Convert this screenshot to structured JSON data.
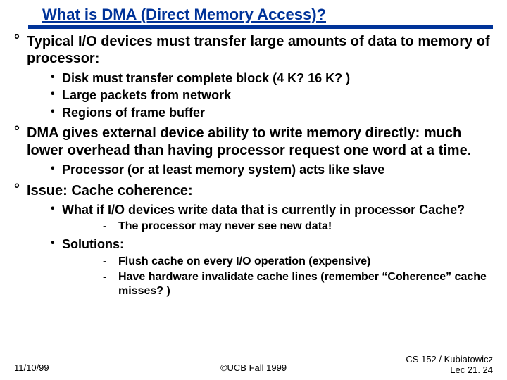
{
  "title": "What is DMA (Direct Memory Access)?",
  "bullets": {
    "b1": "Typical I/O devices must transfer large amounts of data to memory of processor:",
    "b1_sub": {
      "s1": "Disk must transfer complete block (4 K? 16 K? )",
      "s2": "Large packets from network",
      "s3": "Regions of frame buffer"
    },
    "b2": "DMA gives external device ability to write memory directly: much lower overhead than having processor request one word at a time.",
    "b2_sub": {
      "s1": "Processor (or at least memory system) acts like slave"
    },
    "b3": "Issue: Cache coherence:",
    "b3_sub": {
      "s1": "What if I/O devices write data that is currently in processor Cache?",
      "s1_dash": {
        "d1": "The processor may never see new data!"
      },
      "s2": "Solutions:",
      "s2_dash": {
        "d1": "Flush cache on every I/O operation (expensive)",
        "d2": "Have hardware invalidate cache lines (remember “Coherence” cache misses? )"
      }
    }
  },
  "footer": {
    "left": "11/10/99",
    "center": "©UCB Fall 1999",
    "right1": "CS 152 / Kubiatowicz",
    "right2": "Lec 21. 24"
  }
}
